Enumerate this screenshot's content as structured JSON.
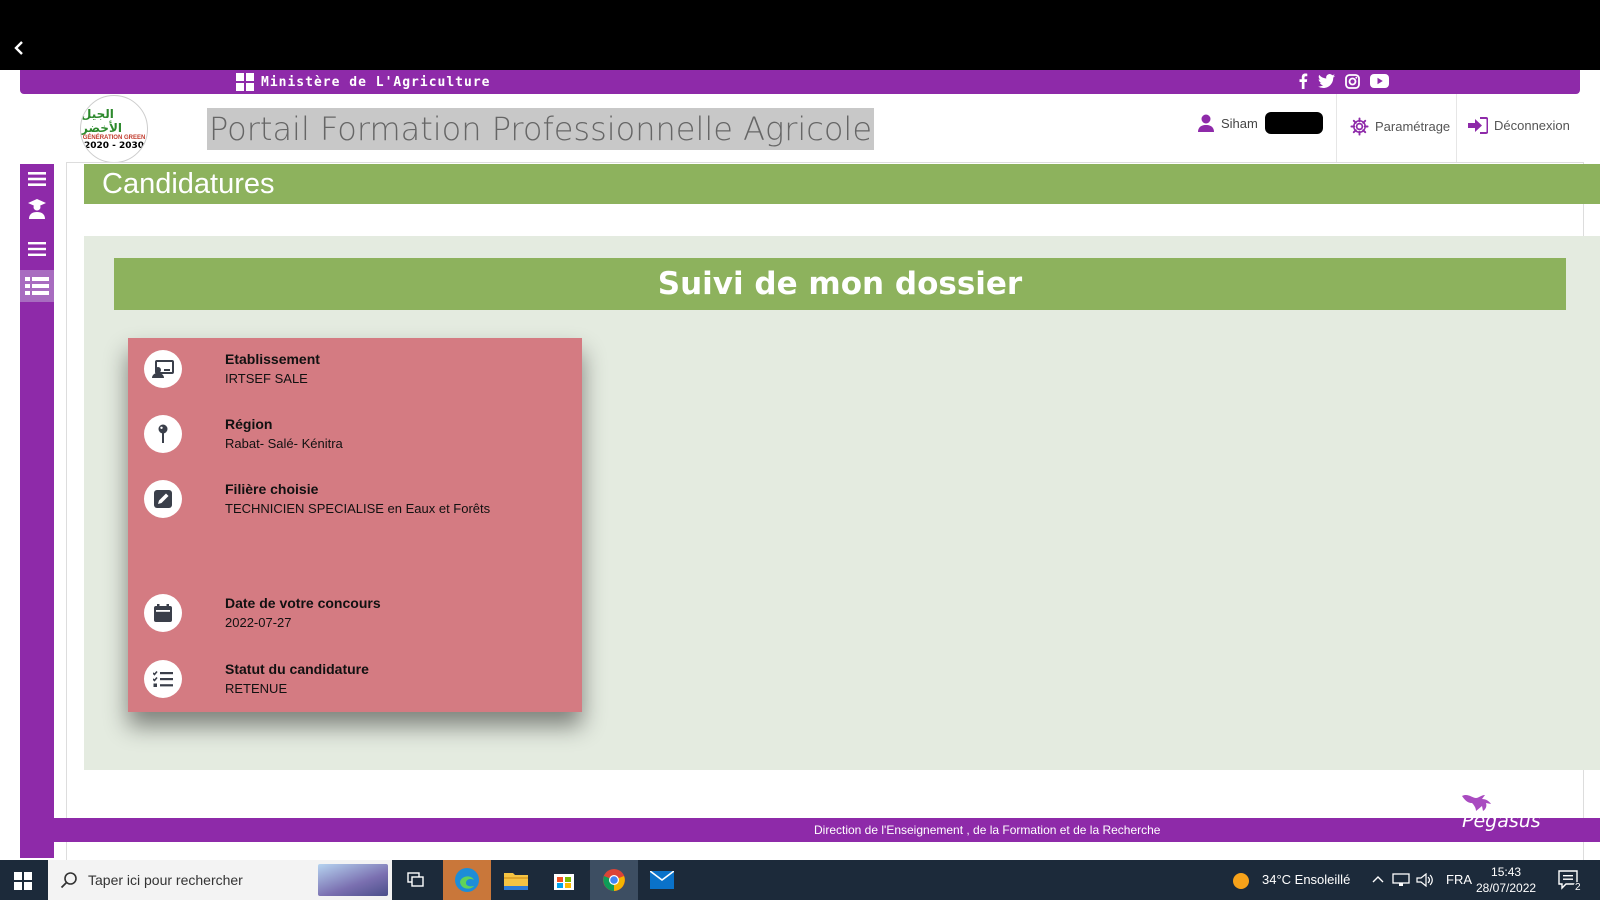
{
  "header": {
    "ministry": "Ministère de L'Agriculture",
    "logo": {
      "arabic": "الجيل الأخضر",
      "generation": "GÉNÉRATION GREEN",
      "years": "2020 - 2030"
    },
    "portal_title": "Portail Formation Professionnelle Agricole",
    "user_name": "Siham",
    "settings_label": "Paramétrage",
    "logout_label": "Déconnexion"
  },
  "page": {
    "title": "Candidatures",
    "section_title": "Suivi de mon dossier"
  },
  "dossier": {
    "items": [
      {
        "icon": "establishment-icon",
        "label": "Etablissement",
        "value": "IRTSEF SALE"
      },
      {
        "icon": "location-pin-icon",
        "label": "Région",
        "value": "Rabat- Salé- Kénitra"
      },
      {
        "icon": "edit-icon",
        "label": "Filière choisie",
        "value": "TECHNICIEN SPECIALISE en Eaux et Forêts"
      },
      {
        "icon": "calendar-icon",
        "label": "Date de votre concours",
        "value": "2022-07-27"
      },
      {
        "icon": "checklist-icon",
        "label": "Statut du candidature",
        "value": "RETENUE"
      }
    ]
  },
  "footer": {
    "text": "Direction de l'Enseignement , de la Formation et de la Recherche",
    "brand": "Pegasus"
  },
  "taskbar": {
    "search_placeholder": "Taper ici pour rechercher",
    "weather": "34°C  Ensoleillé",
    "language": "FRA",
    "time": "15:43",
    "date": "28/07/2022",
    "notifications": "2"
  },
  "colors": {
    "purple": "#8e2aa9",
    "green": "#8db25d",
    "card": "#d47b82",
    "background": "#e4ebe0"
  }
}
